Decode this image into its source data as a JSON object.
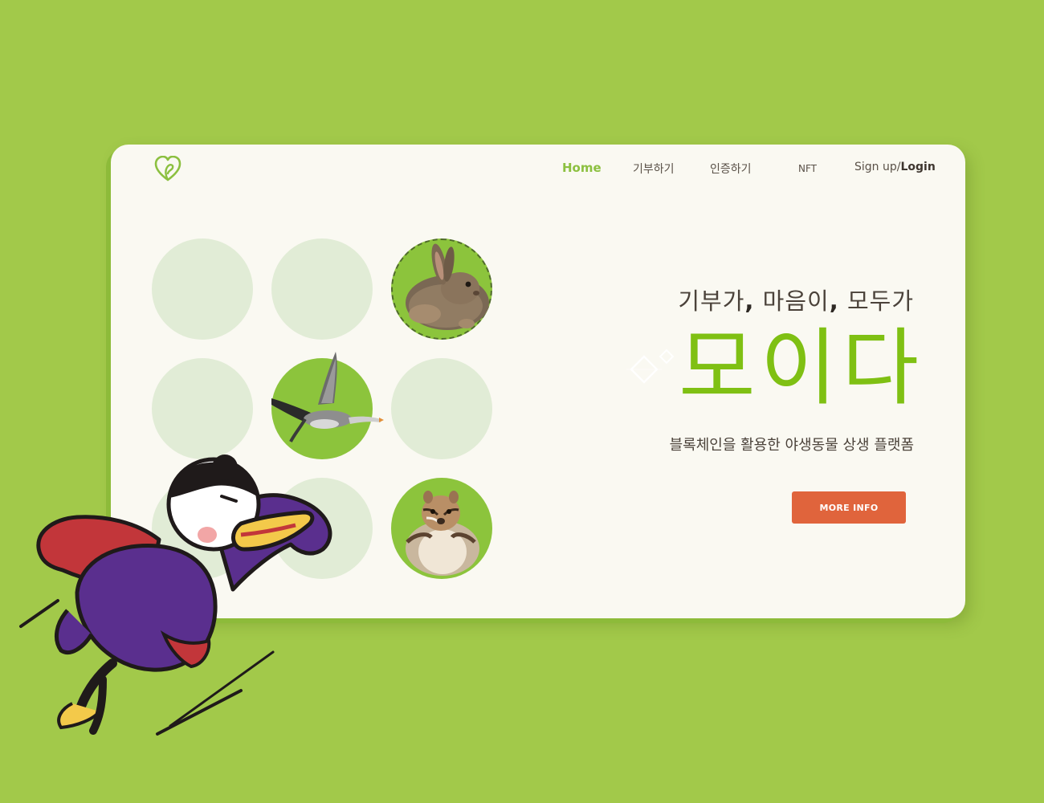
{
  "nav": {
    "home": "Home",
    "donate": "기부하기",
    "verify": "인증하기",
    "nft": "NFT",
    "signup": "Sign up/",
    "login": "Login"
  },
  "hero": {
    "tagline_part1": "기부가",
    "tagline_part2": " 마음이",
    "tagline_part3": " 모두가",
    "comma": ",",
    "title": "모이다",
    "subtitle": "블록체인을 활용한 야생동물 상생 플랫폼",
    "button": "MORE INFO"
  },
  "grid": {
    "animals": [
      "rabbit",
      "goose",
      "chipmunk"
    ]
  },
  "colors": {
    "background": "#a2c94a",
    "card": "#faf9f2",
    "accent_green": "#7fc013",
    "nav_active": "#8cc040",
    "button": "#e0643c",
    "circle_light": "#e1ecd6",
    "circle_green": "#8cc43c"
  },
  "icons": {
    "logo": "heart-leaf-logo",
    "sparkle": "diamond-sparkle",
    "mascot": "duck-mascot"
  }
}
